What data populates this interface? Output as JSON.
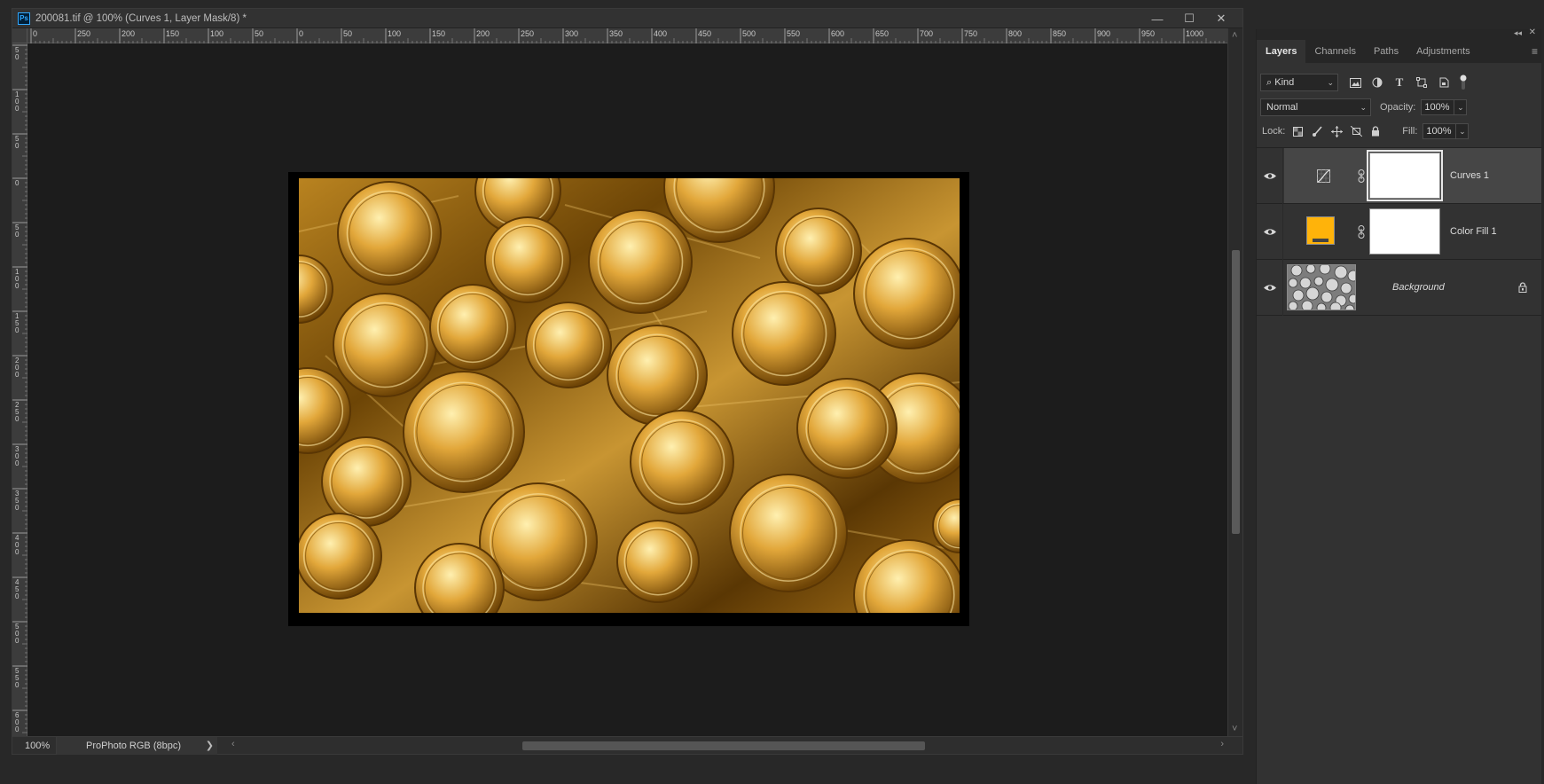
{
  "document": {
    "title": "200081.tif @ 100% (Curves 1, Layer Mask/8) *",
    "app_icon": "Ps",
    "controls": {
      "minimize": "—",
      "maximize": "☐",
      "close": "✕"
    },
    "ruler_top_labels": [
      "0",
      "250",
      "200",
      "150",
      "100",
      "50",
      "0",
      "50",
      "100",
      "150",
      "200",
      "250",
      "300",
      "350",
      "400",
      "450",
      "500",
      "550",
      "600",
      "650",
      "700",
      "750",
      "800",
      "850",
      "900",
      "950",
      "1000"
    ],
    "ruler_left_labels": [
      "5\n0",
      "1\n0\n0",
      "5\n0",
      "0",
      "5\n0",
      "1\n0\n0",
      "1\n5\n0",
      "2\n0\n0",
      "2\n5\n0",
      "3\n0\n0",
      "3\n5\n0",
      "4\n0\n0",
      "4\n5\n0",
      "5\n0\n0",
      "5\n5\n0",
      "6\n0\n0"
    ],
    "status": {
      "zoom": "100%",
      "color_profile": "ProPhoto RGB (8bpc)",
      "profile_arrow": "❯"
    },
    "image_tint": "#c8901e"
  },
  "layers_panel": {
    "tabs": [
      {
        "label": "Layers",
        "active": true
      },
      {
        "label": "Channels",
        "active": false
      },
      {
        "label": "Paths",
        "active": false
      },
      {
        "label": "Adjustments",
        "active": false
      }
    ],
    "collapse_glyph": "◂◂",
    "close_glyph": "✕",
    "menu_glyph": "≡",
    "filter": {
      "kind_label": "Kind",
      "kind_prefix": "⌕"
    },
    "blend_mode": "Normal",
    "opacity_label": "Opacity:",
    "opacity_value": "100%",
    "lock_label": "Lock:",
    "fill_label": "Fill:",
    "fill_value": "100%",
    "layers": [
      {
        "name": "Curves 1",
        "type": "curves",
        "selected": true,
        "visible": true
      },
      {
        "name": "Color Fill 1",
        "type": "color-fill",
        "selected": false,
        "visible": true,
        "color": "#ffb30a"
      },
      {
        "name": "Background",
        "type": "background",
        "selected": false,
        "visible": true,
        "locked": true
      }
    ]
  }
}
